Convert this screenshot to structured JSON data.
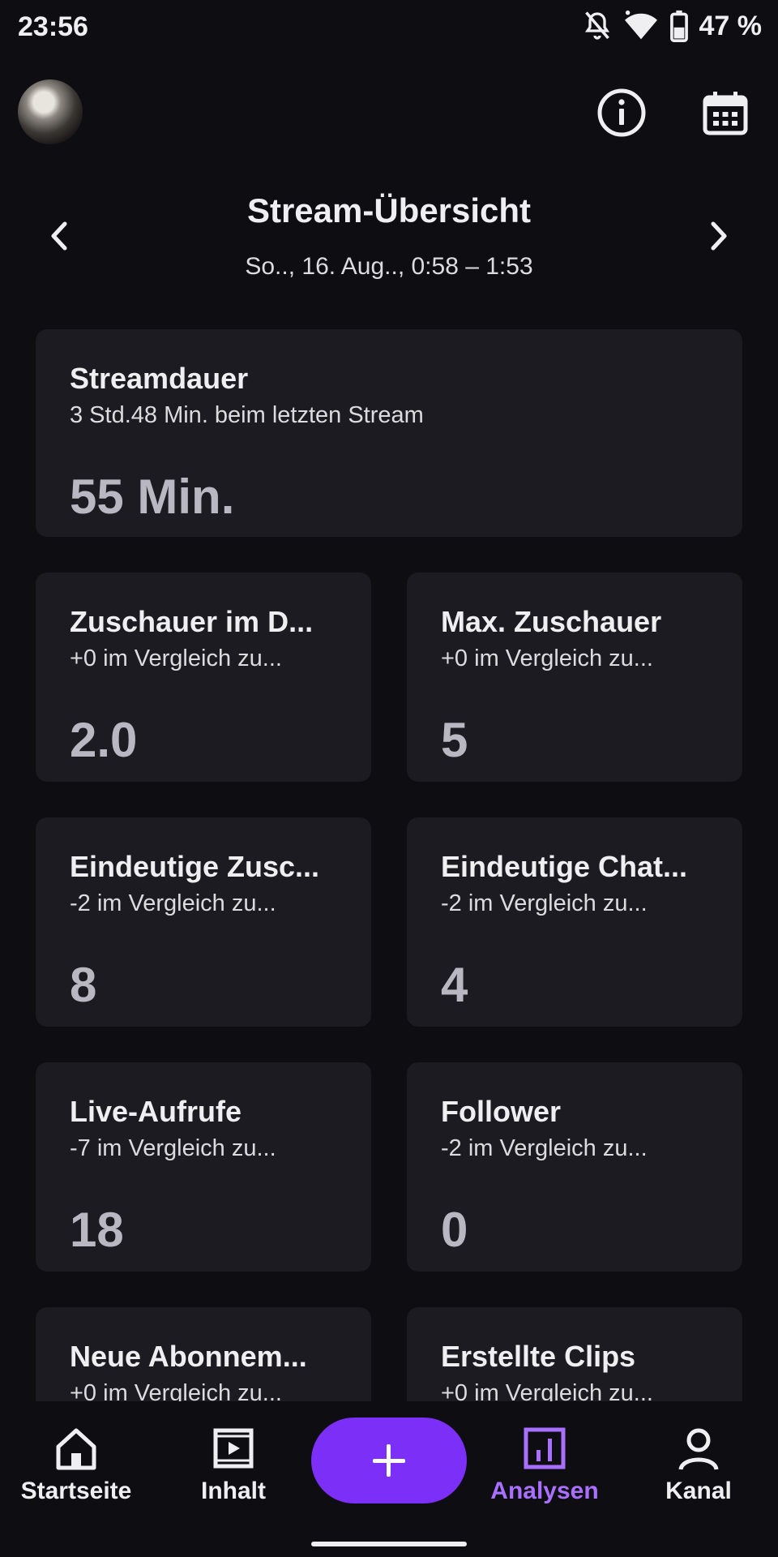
{
  "status_bar": {
    "time": "23:56",
    "battery": "47 %",
    "icons": [
      "bell-off-icon",
      "wifi-icon",
      "battery-icon"
    ]
  },
  "top_bar": {
    "icons": [
      "avatar",
      "info-icon",
      "calendar-icon"
    ]
  },
  "header": {
    "title": "Stream-Übersicht",
    "subtitle": "So.., 16. Aug.., 0:58 – 1:53"
  },
  "cards": {
    "stream_duration": {
      "title": "Streamdauer",
      "subtitle": "3 Std.48 Min. beim letzten Stream",
      "value": "55 Min."
    },
    "avg_viewers": {
      "title": "Zuschauer im D...",
      "subtitle": "+0 im Vergleich zu...",
      "value": "2.0"
    },
    "max_viewers": {
      "title": "Max. Zuschauer",
      "subtitle": "+0 im Vergleich zu...",
      "value": "5"
    },
    "unique_viewers": {
      "title": "Eindeutige Zusc...",
      "subtitle": "-2 im Vergleich zu...",
      "value": "8"
    },
    "unique_chatters": {
      "title": "Eindeutige Chat...",
      "subtitle": "-2 im Vergleich zu...",
      "value": "4"
    },
    "live_views": {
      "title": "Live-Aufrufe",
      "subtitle": "-7 im Vergleich zu...",
      "value": "18"
    },
    "followers": {
      "title": "Follower",
      "subtitle": "-2 im Vergleich zu...",
      "value": "0"
    },
    "new_subs": {
      "title": "Neue Abonnem...",
      "subtitle": "+0 im Vergleich zu...",
      "value": ""
    },
    "clips_created": {
      "title": "Erstellte Clips",
      "subtitle": "+0 im Vergleich zu...",
      "value": ""
    }
  },
  "bottom_nav": {
    "items": [
      {
        "label": "Startseite",
        "icon": "home-icon"
      },
      {
        "label": "Inhalt",
        "icon": "content-icon"
      },
      {
        "label": "Analysen",
        "icon": "analytics-icon"
      },
      {
        "label": "Kanal",
        "icon": "profile-icon"
      }
    ],
    "active_label": "Analysen",
    "fab_icon": "plus-icon"
  },
  "colors": {
    "background": "#0e0d12",
    "card": "#1c1b21",
    "accent": "#7b2ff7",
    "active_nav": "#a970ff",
    "value_text": "#b9b8c2"
  }
}
